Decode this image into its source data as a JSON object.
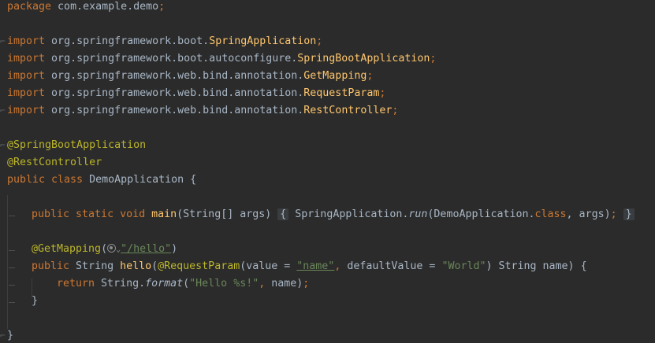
{
  "editor": {
    "package_line": {
      "kw": "package",
      "name": " com.example.demo",
      "semi": ";"
    },
    "imports": [
      {
        "kw": "import",
        "path": " org.springframework.boot.",
        "cls": "SpringApplication",
        "semi": ";"
      },
      {
        "kw": "import",
        "path": " org.springframework.boot.autoconfigure.",
        "cls": "SpringBootApplication",
        "semi": ";"
      },
      {
        "kw": "import",
        "path": " org.springframework.web.bind.annotation.",
        "cls": "GetMapping",
        "semi": ";"
      },
      {
        "kw": "import",
        "path": " org.springframework.web.bind.annotation.",
        "cls": "RequestParam",
        "semi": ";"
      },
      {
        "kw": "import",
        "path": " org.springframework.web.bind.annotation.",
        "cls": "RestController",
        "semi": ";"
      }
    ],
    "annotations": [
      "@SpringBootApplication",
      "@RestController"
    ],
    "class_decl": {
      "kw": "public class",
      "name": " DemoApplication {"
    },
    "main_method": {
      "kw": "public static void",
      "name": "main",
      "params": "(String[] args)",
      "folded_body_open": "{",
      "call_target": " SpringApplication.",
      "call_method": "run",
      "call_args_1": "(DemoApplication.",
      "class_kw": "class",
      "call_args_2": ", args)",
      "semi": ";",
      "folded_body_close": "}"
    },
    "get_mapping": {
      "annotation": "@GetMapping",
      "open": "(",
      "path": "\"/hello\"",
      "close": ")"
    },
    "hello_method": {
      "kw": "public",
      "ret": " String ",
      "name": "hello",
      "open": "(",
      "param_ann": "@RequestParam",
      "p1": "(value = ",
      "value_str": "\"name\"",
      "comma": ",",
      "p2": " defaultValue = ",
      "default_str": "\"World\"",
      "p3": ") String name) {"
    },
    "return_line": {
      "kw": "return",
      "target": " String.",
      "method": "format",
      "open": "(",
      "fmt": "\"Hello %s!\"",
      "comma": ",",
      "rest": " name)",
      "semi": ";"
    },
    "method_close": "}",
    "class_close": "}"
  },
  "icons": {
    "web_endpoint": "web-endpoint-icon",
    "dropdown": "chevron-down-icon"
  },
  "colors": {
    "background": "#2b2b2b",
    "keyword": "#cc7832",
    "annotation": "#bbb529",
    "function": "#ffc66d",
    "string": "#6a8759",
    "text": "#a9b7c6"
  }
}
